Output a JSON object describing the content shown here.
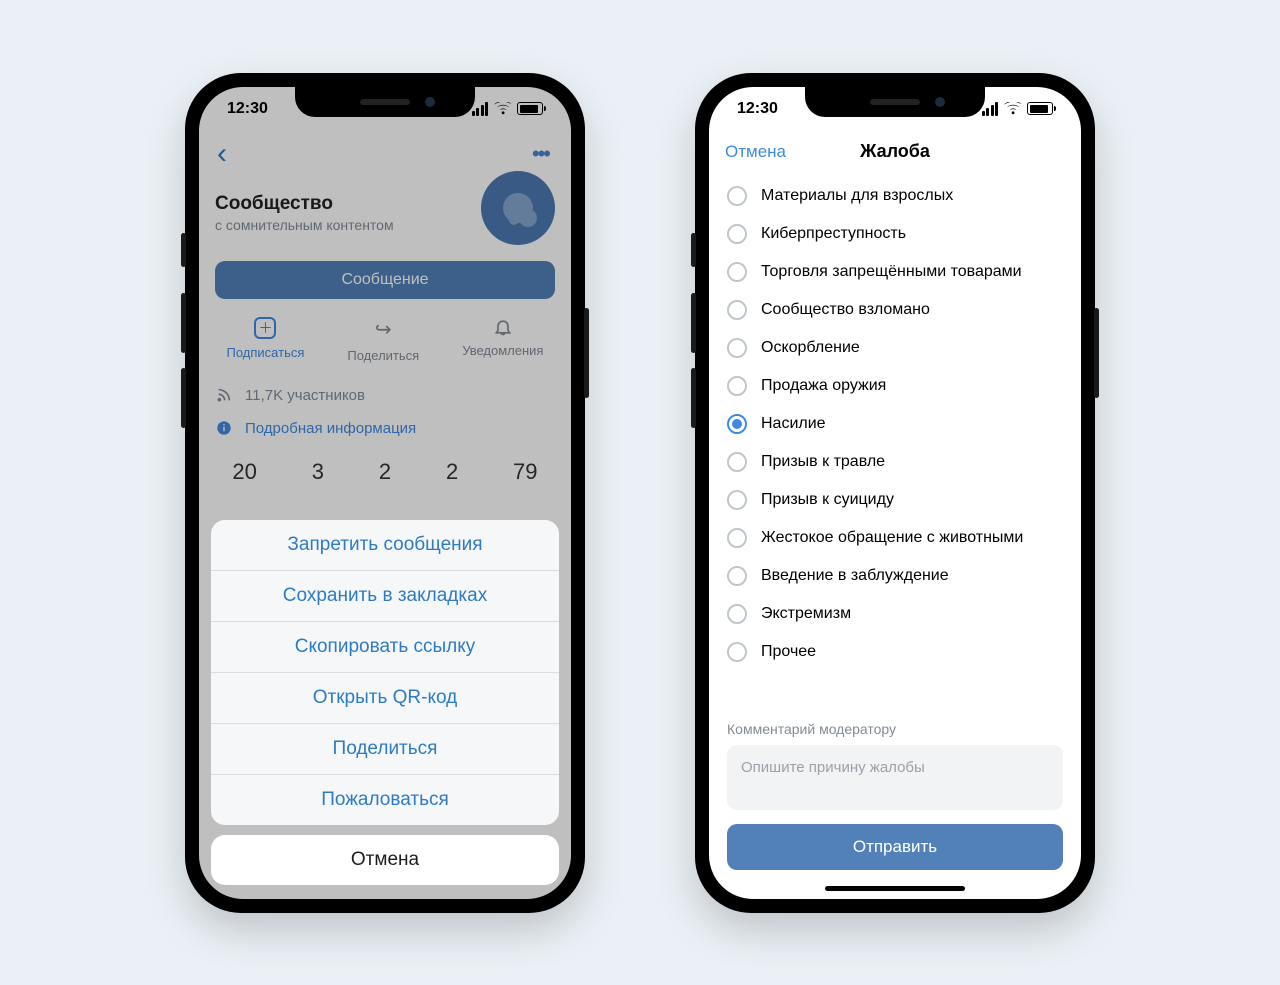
{
  "status": {
    "time": "12:30"
  },
  "left": {
    "group_title": "Сообщество",
    "group_subtitle": "с сомнительным контентом",
    "message_button": "Сообщение",
    "actions": {
      "subscribe": "Подписаться",
      "share": "Поделиться",
      "notifications": "Уведомления"
    },
    "members_line": "11,7K участников",
    "details_line": "Подробная информация",
    "stats": [
      "20",
      "3",
      "2",
      "2",
      "79"
    ],
    "sheet": {
      "items": [
        "Запретить сообщения",
        "Сохранить в закладках",
        "Скопировать ссылку",
        "Открыть QR-код",
        "Поделиться",
        "Пожаловаться"
      ],
      "cancel": "Отмена"
    }
  },
  "right": {
    "cancel": "Отмена",
    "title": "Жалоба",
    "reasons": [
      {
        "label": "Материалы для взрослых",
        "selected": false
      },
      {
        "label": "Киберпреступность",
        "selected": false
      },
      {
        "label": "Торговля запрещёнными товарами",
        "selected": false
      },
      {
        "label": "Сообщество взломано",
        "selected": false
      },
      {
        "label": "Оскорбление",
        "selected": false
      },
      {
        "label": "Продажа оружия",
        "selected": false
      },
      {
        "label": "Насилие",
        "selected": true
      },
      {
        "label": "Призыв к травле",
        "selected": false
      },
      {
        "label": "Призыв к суициду",
        "selected": false
      },
      {
        "label": "Жестокое обращение с животными",
        "selected": false
      },
      {
        "label": "Введение в заблуждение",
        "selected": false
      },
      {
        "label": "Экстремизм",
        "selected": false
      },
      {
        "label": "Прочее",
        "selected": false
      }
    ],
    "comment_label": "Комментарий модератору",
    "comment_placeholder": "Опишите причину жалобы",
    "submit": "Отправить"
  }
}
